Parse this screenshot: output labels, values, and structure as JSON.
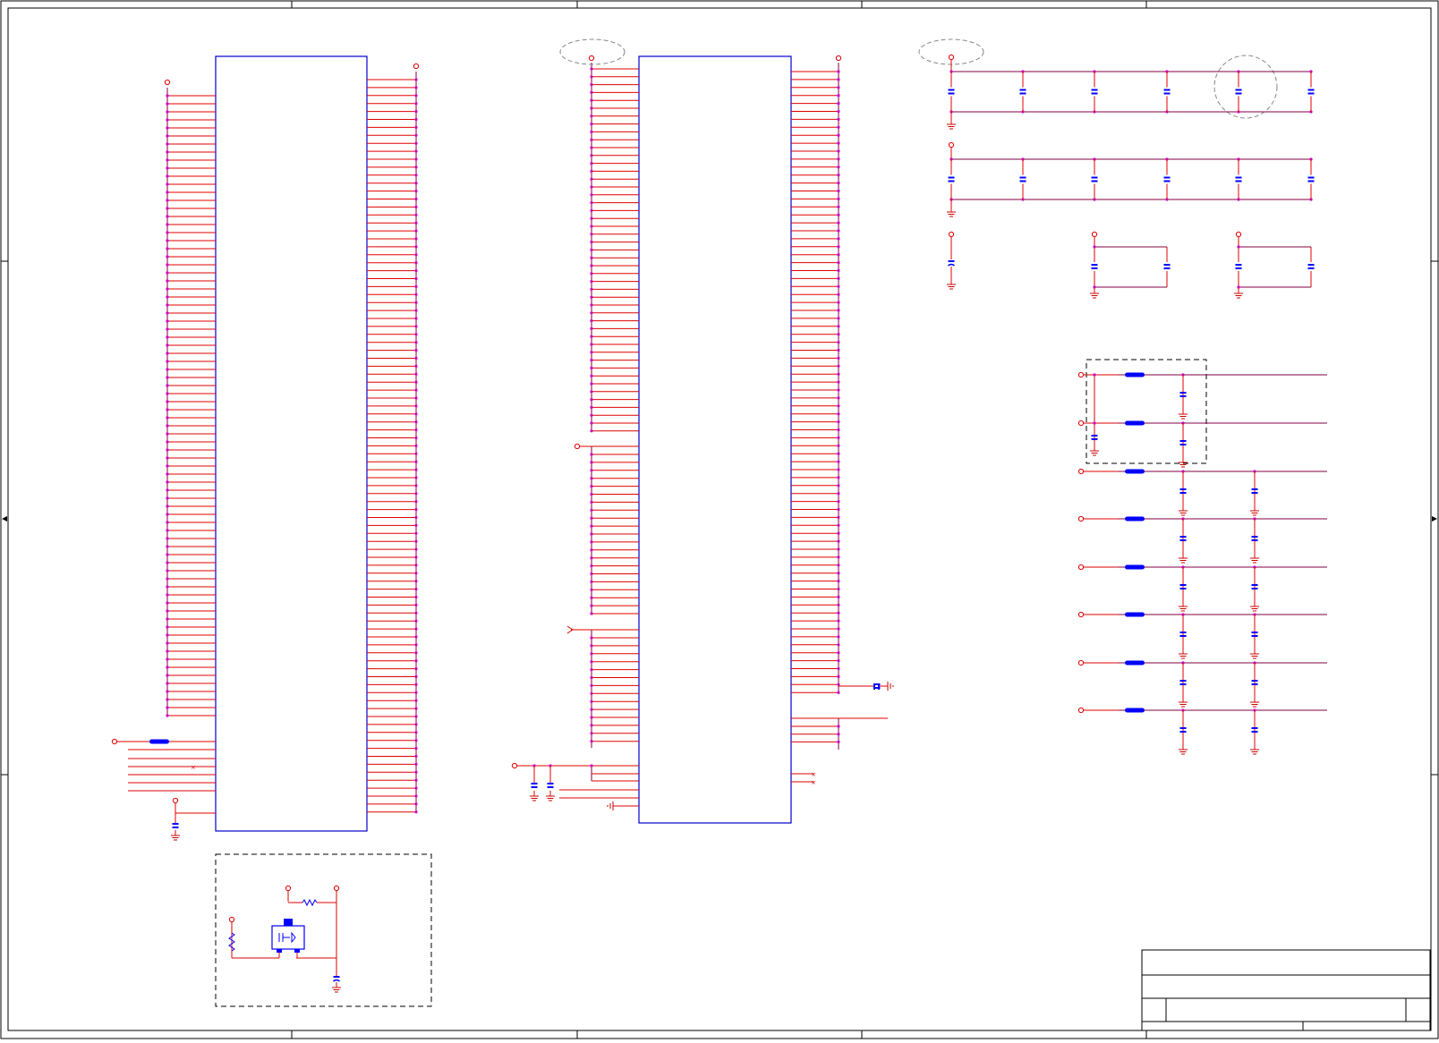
{
  "sheet": {
    "background": "#ffffff",
    "border_color": "#000000",
    "colors": {
      "wire": "#e00000",
      "net": "#800040",
      "pin": "#cc00cc",
      "body": "#0000cc",
      "component": "#0000ff",
      "annotation": "#888888",
      "ground": "#cc0000"
    }
  }
}
